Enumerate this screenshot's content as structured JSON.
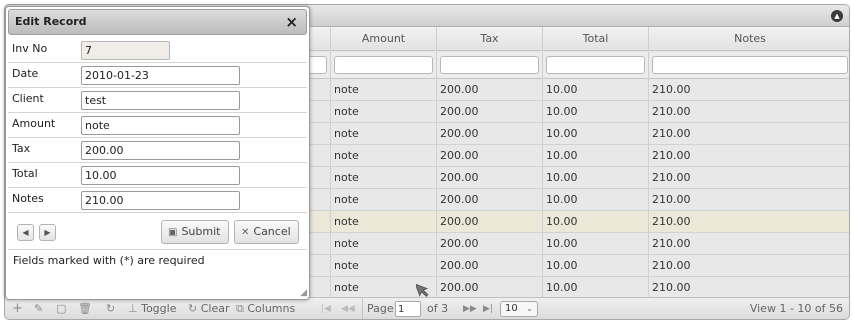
{
  "grid": {
    "columns": [
      "Amount",
      "Tax",
      "Total",
      "Notes"
    ],
    "rows": [
      [
        "note",
        "200.00",
        "10.00",
        "210.00"
      ],
      [
        "note",
        "200.00",
        "10.00",
        "210.00"
      ],
      [
        "note",
        "200.00",
        "10.00",
        "210.00"
      ],
      [
        "note",
        "200.00",
        "10.00",
        "210.00"
      ],
      [
        "note",
        "200.00",
        "10.00",
        "210.00"
      ],
      [
        "note",
        "200.00",
        "10.00",
        "210.00"
      ],
      [
        "note",
        "200.00",
        "10.00",
        "210.00"
      ],
      [
        "note",
        "200.00",
        "10.00",
        "210.00"
      ],
      [
        "note",
        "200.00",
        "10.00",
        "210.00"
      ],
      [
        "note",
        "200.00",
        "10.00",
        "210.00"
      ]
    ],
    "selected_row": 6
  },
  "pager": {
    "toggle_label": "Toggle",
    "clear_label": "Clear",
    "columns_label": "Columns",
    "page_label": "Page",
    "page_value": "1",
    "of_label": "of 3",
    "page_size": "10",
    "view_text": "View 1 - 10 of 56"
  },
  "dialog": {
    "title": "Edit Record",
    "close_icon": "×",
    "fields": [
      {
        "label": "Inv No",
        "value": "7",
        "readonly": true
      },
      {
        "label": "Date",
        "value": "2010-01-23"
      },
      {
        "label": "Client",
        "value": "test"
      },
      {
        "label": "Amount",
        "value": "note"
      },
      {
        "label": "Tax",
        "value": "200.00"
      },
      {
        "label": "Total",
        "value": "10.00"
      },
      {
        "label": "Notes",
        "value": "210.00"
      }
    ],
    "submit_label": "Submit",
    "cancel_label": "Cancel",
    "required_note": "Fields marked with (*) are required"
  },
  "colors": {
    "row_background": "#e8e8e8",
    "selected_row_background": "#ebe8d8",
    "titlebar_gradient": "#cfcfcf"
  }
}
